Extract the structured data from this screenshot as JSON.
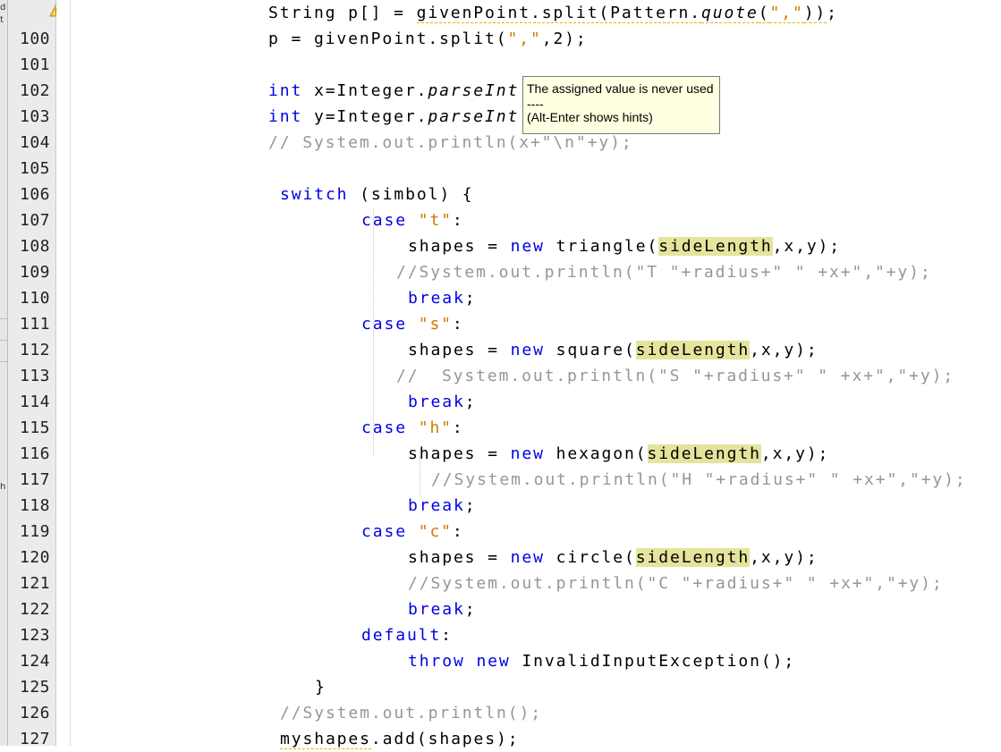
{
  "side_panel": {
    "fragments": [
      "d",
      "t",
      "h"
    ]
  },
  "gutter": {
    "line_numbers": [
      "100",
      "101",
      "102",
      "103",
      "104",
      "105",
      "106",
      "107",
      "108",
      "109",
      "110",
      "111",
      "112",
      "113",
      "114",
      "115",
      "116",
      "117",
      "118",
      "119",
      "120",
      "121",
      "122",
      "123",
      "124",
      "125",
      "126",
      "127"
    ],
    "warning_icon": "warning-bulb-icon"
  },
  "editor": {
    "lines": [
      {
        "indent": 300,
        "tokens": [
          {
            "t": "String p[] = "
          },
          {
            "t": "givenPoint.split(Pattern.",
            "c": "squig"
          },
          {
            "t": "quote",
            "c": "it squig"
          },
          {
            "t": "(",
            "c": "squig"
          },
          {
            "t": "\",\"",
            "c": "str squig"
          },
          {
            "t": "))",
            "c": "squig"
          },
          {
            "t": ";"
          }
        ]
      },
      {
        "indent": 300,
        "tokens": [
          {
            "t": "p = givenPoint.split("
          },
          {
            "t": "\",\"",
            "c": "str"
          },
          {
            "t": ",2);"
          }
        ]
      },
      {
        "indent": 300,
        "tokens": []
      },
      {
        "indent": 300,
        "tokens": [
          {
            "t": "int",
            "c": "kw"
          },
          {
            "t": " x=Integer."
          },
          {
            "t": "parseInt",
            "c": "it"
          }
        ]
      },
      {
        "indent": 300,
        "tokens": [
          {
            "t": "int",
            "c": "kw"
          },
          {
            "t": " y=Integer."
          },
          {
            "t": "parseInt",
            "c": "it"
          }
        ]
      },
      {
        "indent": 300,
        "tokens": [
          {
            "t": "// System.out.println(x+\"\\n\"+y);",
            "c": "cm"
          }
        ]
      },
      {
        "indent": 300,
        "tokens": []
      },
      {
        "indent": 313,
        "tokens": [
          {
            "t": "switch",
            "c": "kw"
          },
          {
            "t": " (simbol) {"
          }
        ]
      },
      {
        "indent": 404,
        "tokens": [
          {
            "t": "case",
            "c": "kw"
          },
          {
            "t": " "
          },
          {
            "t": "\"t\"",
            "c": "str"
          },
          {
            "t": ":"
          }
        ]
      },
      {
        "indent": 456,
        "tokens": [
          {
            "t": "shapes = "
          },
          {
            "t": "new",
            "c": "kw"
          },
          {
            "t": " triangle("
          },
          {
            "t": "sideLength",
            "c": "hl"
          },
          {
            "t": ",x,y);"
          }
        ]
      },
      {
        "indent": 443,
        "tokens": [
          {
            "t": "//System.out.println(\"T \"+radius+\" \" +x+\",\"+y);",
            "c": "cm"
          }
        ]
      },
      {
        "indent": 456,
        "tokens": [
          {
            "t": "break",
            "c": "kw"
          },
          {
            "t": ";"
          }
        ]
      },
      {
        "indent": 404,
        "tokens": [
          {
            "t": "case",
            "c": "kw"
          },
          {
            "t": " "
          },
          {
            "t": "\"s\"",
            "c": "str"
          },
          {
            "t": ":"
          }
        ]
      },
      {
        "indent": 456,
        "tokens": [
          {
            "t": "shapes = "
          },
          {
            "t": "new",
            "c": "kw"
          },
          {
            "t": " square("
          },
          {
            "t": "sideLength",
            "c": "hl"
          },
          {
            "t": ",x,y);"
          }
        ]
      },
      {
        "indent": 443,
        "tokens": [
          {
            "t": "//  System.out.println(\"S \"+radius+\" \" +x+\",\"+y);",
            "c": "cm"
          }
        ]
      },
      {
        "indent": 456,
        "tokens": [
          {
            "t": "break",
            "c": "kw"
          },
          {
            "t": ";"
          }
        ]
      },
      {
        "indent": 404,
        "tokens": [
          {
            "t": "case",
            "c": "kw"
          },
          {
            "t": " "
          },
          {
            "t": "\"h\"",
            "c": "str"
          },
          {
            "t": ":"
          }
        ]
      },
      {
        "indent": 456,
        "tokens": [
          {
            "t": "shapes = "
          },
          {
            "t": "new",
            "c": "kw"
          },
          {
            "t": " hexagon("
          },
          {
            "t": "sideLength",
            "c": "hl"
          },
          {
            "t": ",x,y);"
          }
        ]
      },
      {
        "indent": 482,
        "tokens": [
          {
            "t": "//System.out.println(\"H \"+radius+\" \" +x+\",\"+y);",
            "c": "cm"
          }
        ]
      },
      {
        "indent": 456,
        "tokens": [
          {
            "t": "break",
            "c": "kw"
          },
          {
            "t": ";"
          }
        ]
      },
      {
        "indent": 404,
        "tokens": [
          {
            "t": "case",
            "c": "kw"
          },
          {
            "t": " "
          },
          {
            "t": "\"c\"",
            "c": "str"
          },
          {
            "t": ":"
          }
        ]
      },
      {
        "indent": 456,
        "tokens": [
          {
            "t": "shapes = "
          },
          {
            "t": "new",
            "c": "kw"
          },
          {
            "t": " circle("
          },
          {
            "t": "sideLength",
            "c": "hl"
          },
          {
            "t": ",x,y);"
          }
        ]
      },
      {
        "indent": 456,
        "tokens": [
          {
            "t": "//System.out.println(\"C \"+radius+\" \" +x+\",\"+y);",
            "c": "cm"
          }
        ]
      },
      {
        "indent": 456,
        "tokens": [
          {
            "t": "break",
            "c": "kw"
          },
          {
            "t": ";"
          }
        ]
      },
      {
        "indent": 404,
        "tokens": [
          {
            "t": "default",
            "c": "kw"
          },
          {
            "t": ":"
          }
        ]
      },
      {
        "indent": 456,
        "tokens": [
          {
            "t": "throw",
            "c": "kw"
          },
          {
            "t": " "
          },
          {
            "t": "new",
            "c": "kw"
          },
          {
            "t": " InvalidInputException();"
          }
        ]
      },
      {
        "indent": 352,
        "tokens": [
          {
            "t": "}"
          }
        ]
      },
      {
        "indent": 313,
        "tokens": [
          {
            "t": "//System.out.println();",
            "c": "cm"
          }
        ]
      },
      {
        "indent": 313,
        "tokens": [
          {
            "t": "myshapes",
            "c": "squig"
          },
          {
            "t": ".add(shapes);"
          }
        ]
      }
    ]
  },
  "tooltip": {
    "message": "The assigned value is never used",
    "separator": "----",
    "hint": "(Alt-Enter shows hints)"
  },
  "colors": {
    "keyword": "#0000e6",
    "string": "#ce7b00",
    "comment": "#969696",
    "highlight": "#e4e49c",
    "tooltip_bg": "#ffffe1"
  }
}
